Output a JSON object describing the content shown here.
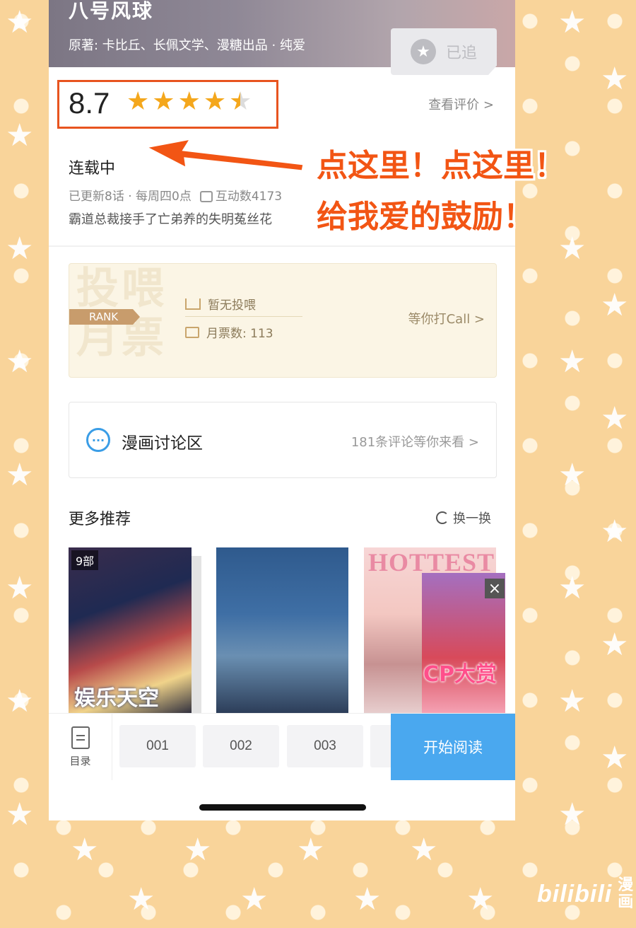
{
  "header": {
    "title": "八号风球",
    "meta": "原著: 卡比丘、长佩文学、漫糖出品 · 纯爱",
    "follow_label": "已追"
  },
  "rating": {
    "score": "8.7",
    "stars": 4.5,
    "view_reviews": "查看评价 >"
  },
  "annotation": {
    "line1": "点这里！点这里！",
    "line2": "给我爱的鼓励！"
  },
  "info": {
    "status": "连载中",
    "updates": "已更新8话 · 每周四0点",
    "interactions": "互动数4173",
    "description": "霸道总裁接手了亡弟养的失明菟丝花"
  },
  "rank": {
    "bg_text_line1": "投喂",
    "bg_text_line2": "月票",
    "tag": "RANK",
    "feed_status": "暂无投喂",
    "monthly_tickets": "月票数: 113",
    "call_link": "等你打Call >"
  },
  "discussion": {
    "title": "漫画讨论区",
    "count": "181条评论等你来看 >"
  },
  "recommend": {
    "title": "更多推荐",
    "refresh": "换一换",
    "items": [
      {
        "tag": "9部",
        "title": "娱乐天空"
      },
      {
        "tag": "",
        "title": ""
      },
      {
        "tag": "",
        "title": "HOTTEST"
      }
    ],
    "ad_text": "CP大赏"
  },
  "bottom": {
    "toc_label": "目录",
    "episodes": [
      "001",
      "002",
      "003"
    ],
    "start_label": "开始阅读"
  },
  "watermark": {
    "logo": "bilibili",
    "side": "漫画"
  },
  "colors": {
    "accent_orange": "#f25514",
    "star": "#f4a71c",
    "primary_blue": "#4aa8ef"
  }
}
